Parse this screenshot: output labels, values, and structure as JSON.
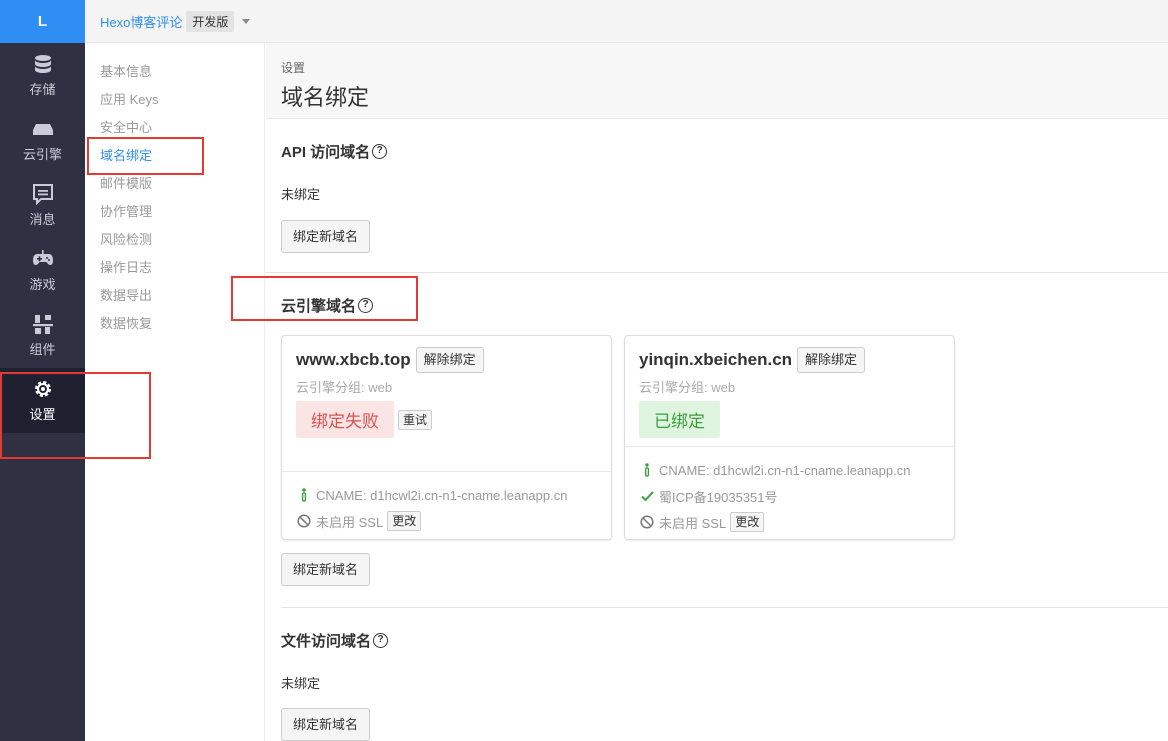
{
  "nav": {
    "logo": "L",
    "items": [
      {
        "label": "存储",
        "icon": "database-icon"
      },
      {
        "label": "云引擎",
        "icon": "server-icon"
      },
      {
        "label": "消息",
        "icon": "message-icon"
      },
      {
        "label": "游戏",
        "icon": "gamepad-icon"
      },
      {
        "label": "组件",
        "icon": "components-icon"
      },
      {
        "label": "设置",
        "icon": "gear-icon",
        "active": true
      }
    ]
  },
  "topbar": {
    "app_name": "Hexo博客评论",
    "env": "开发版"
  },
  "submenu": {
    "items": [
      "基本信息",
      "应用 Keys",
      "安全中心",
      "域名绑定",
      "邮件模版",
      "协作管理",
      "风险检测",
      "操作日志",
      "数据导出",
      "数据恢复"
    ],
    "active": "域名绑定"
  },
  "page": {
    "breadcrumb": "设置",
    "title": "域名绑定"
  },
  "api_section": {
    "title": "API 访问域名",
    "status": "未绑定",
    "bind_button": "绑定新域名"
  },
  "engine_section": {
    "title": "云引擎域名",
    "bind_button": "绑定新域名",
    "cards": [
      {
        "domain": "www.xbcb.top",
        "unbind": "解除绑定",
        "group": "云引擎分组: web",
        "status": "绑定失败",
        "retry": "重试",
        "cname": "CNAME: d1hcwl2i.cn-n1-cname.leanapp.cn",
        "ssl": "未启用 SSL",
        "change": "更改"
      },
      {
        "domain": "yinqin.xbeichen.cn",
        "unbind": "解除绑定",
        "group": "云引擎分组: web",
        "status": "已绑定",
        "cname": "CNAME: d1hcwl2i.cn-n1-cname.leanapp.cn",
        "icp": "蜀ICP备19035351号",
        "ssl": "未启用 SSL",
        "change": "更改"
      }
    ]
  },
  "file_section": {
    "title": "文件访问域名",
    "status": "未绑定",
    "bind_button": "绑定新域名"
  },
  "colors": {
    "accent": "#2f8ef3",
    "nav_bg": "#2f3042",
    "highlight": "#e53935",
    "fail": "#d9534f",
    "success": "#3c9f3c"
  }
}
